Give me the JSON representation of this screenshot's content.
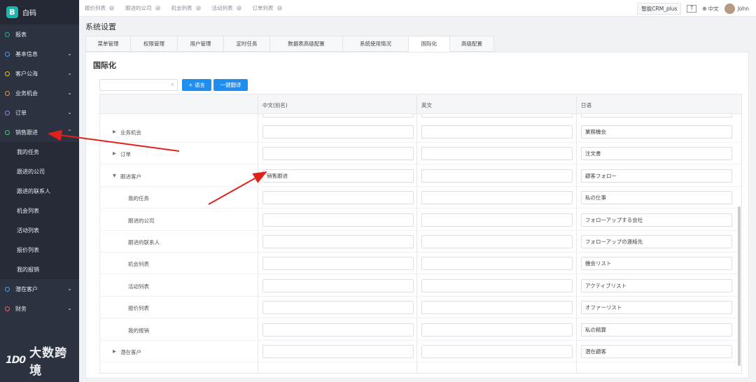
{
  "app": {
    "name": "白码"
  },
  "sidebar": {
    "items": [
      {
        "label": "报表",
        "dot": "#1bb5b0",
        "chevron": false
      },
      {
        "label": "基本信息",
        "dot": "#3aa0ff",
        "chevron": true
      },
      {
        "label": "客户公海",
        "dot": "#f2c200",
        "chevron": true
      },
      {
        "label": "业务机会",
        "dot": "#f0932b",
        "chevron": true
      },
      {
        "label": "订单",
        "dot": "#a57cf5",
        "chevron": true
      },
      {
        "label": "销售跟进",
        "dot": "#3ecf66",
        "chevron": true,
        "expanded": true
      }
    ],
    "sub_items": [
      "我的任务",
      "跟进的公司",
      "跟进的联系人",
      "机会列表",
      "活动列表",
      "报价列表",
      "我的报销"
    ],
    "bottom_items": [
      {
        "label": "潜在客户",
        "dot": "#3aa0ff",
        "chevron": true
      },
      {
        "label": "财务",
        "dot": "#ff5a5a",
        "chevron": true
      }
    ],
    "watermark": {
      "logo": "1D0",
      "text": "大数跨境"
    }
  },
  "topbar": {
    "tabs": [
      "报价列表",
      "跟进的公司",
      "机会列表",
      "活动列表",
      "订单列表"
    ],
    "crm_label": "智能CRM_plus",
    "language": "中文",
    "user": "John"
  },
  "page": {
    "title": "系统设置",
    "tabs": [
      "菜单管理",
      "权限管理",
      "用户管理",
      "定时任务",
      "数据表高级配置",
      "系统使用情况",
      "国际化",
      "高级配置"
    ],
    "active_tab": "国际化"
  },
  "i18n": {
    "title": "国际化",
    "search_placeholder": "",
    "add_language_button": "+ 语言",
    "translate_button": "一键翻译",
    "columns": [
      "中文(别名)",
      "英文",
      "日语"
    ],
    "rows": [
      {
        "label": "业务机会",
        "indent": 1,
        "toggle": "collapsed",
        "zh": "",
        "en": "",
        "ja": "業務機会"
      },
      {
        "label": "订单",
        "indent": 1,
        "toggle": "collapsed",
        "zh": "",
        "en": "",
        "ja": "注文書"
      },
      {
        "label": "跟进客户",
        "indent": 1,
        "toggle": "expanded",
        "zh": "销售跟进",
        "en": "",
        "ja": "顧客フォロー"
      },
      {
        "label": "我的任务",
        "indent": 2,
        "toggle": "none",
        "zh": "",
        "en": "",
        "ja": "私の仕事"
      },
      {
        "label": "跟进的公司",
        "indent": 2,
        "toggle": "none",
        "zh": "",
        "en": "",
        "ja": "フォローアップする会社"
      },
      {
        "label": "跟进的联系人",
        "indent": 2,
        "toggle": "none",
        "zh": "",
        "en": "",
        "ja": "フォローアップの連絡先"
      },
      {
        "label": "机会列表",
        "indent": 2,
        "toggle": "none",
        "zh": "",
        "en": "",
        "ja": "機会リスト"
      },
      {
        "label": "活动列表",
        "indent": 2,
        "toggle": "none",
        "zh": "",
        "en": "",
        "ja": "アクティブリスト"
      },
      {
        "label": "报价列表",
        "indent": 2,
        "toggle": "none",
        "zh": "",
        "en": "",
        "ja": "オファーリスト"
      },
      {
        "label": "我的报销",
        "indent": 2,
        "toggle": "none",
        "zh": "",
        "en": "",
        "ja": "私の精算"
      },
      {
        "label": "潜在客户",
        "indent": 1,
        "toggle": "collapsed",
        "zh": "",
        "en": "",
        "ja": "潜在顧客"
      }
    ]
  },
  "colors": {
    "accent": "#1f8ef1",
    "sidebar_bg": "#2c3240",
    "arrow": "#e0221b"
  }
}
